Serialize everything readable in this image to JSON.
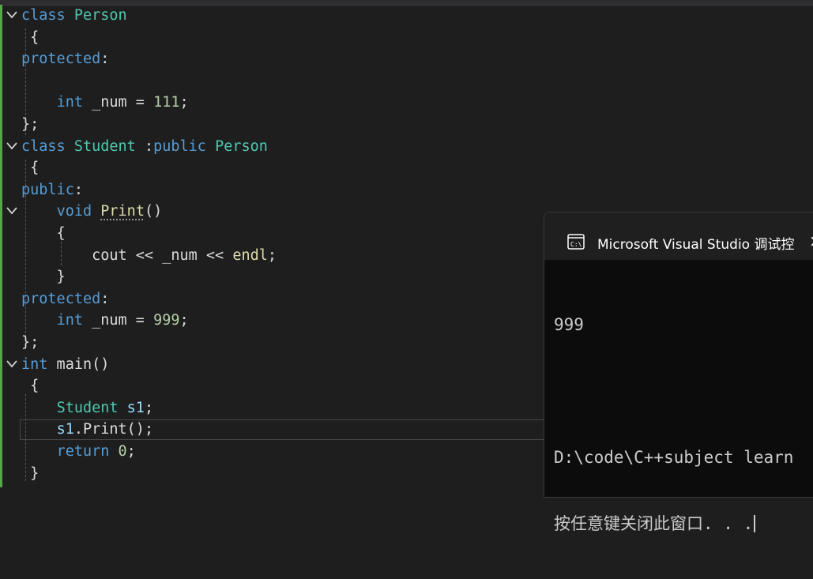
{
  "editor": {
    "lines": [
      {
        "t": [
          [
            "class",
            "kw"
          ],
          [
            " ",
            "pu"
          ],
          [
            "Person",
            "ty"
          ]
        ]
      },
      {
        "t": [
          [
            " {",
            "pu"
          ]
        ]
      },
      {
        "t": [
          [
            "protected",
            "kw"
          ],
          [
            ":",
            "pu"
          ]
        ]
      },
      {
        "t": [
          [
            "",
            "pu"
          ]
        ]
      },
      {
        "t": [
          [
            "    ",
            "pu"
          ],
          [
            "int",
            "kw"
          ],
          [
            " _num = ",
            "pu"
          ],
          [
            "111",
            "nm"
          ],
          [
            ";",
            "pu"
          ]
        ]
      },
      {
        "t": [
          [
            "};",
            "pu"
          ]
        ]
      },
      {
        "t": [
          [
            "class",
            "kw"
          ],
          [
            " ",
            "pu"
          ],
          [
            "Student",
            "ty"
          ],
          [
            " :",
            "pu"
          ],
          [
            "public",
            "kw"
          ],
          [
            " ",
            "pu"
          ],
          [
            "Person",
            "ty"
          ]
        ]
      },
      {
        "t": [
          [
            " {",
            "pu"
          ]
        ]
      },
      {
        "t": [
          [
            "public",
            "kw"
          ],
          [
            ":",
            "pu"
          ]
        ]
      },
      {
        "t": [
          [
            "    ",
            "pu"
          ],
          [
            "void",
            "kw"
          ],
          [
            " ",
            "pu"
          ],
          [
            "Print",
            "fn"
          ],
          [
            "()",
            "pu"
          ]
        ]
      },
      {
        "t": [
          [
            "    {",
            "pu"
          ]
        ]
      },
      {
        "t": [
          [
            "        cout << _num << ",
            "pu"
          ],
          [
            "endl",
            "fn"
          ],
          [
            ";",
            "pu"
          ]
        ]
      },
      {
        "t": [
          [
            "    }",
            "pu"
          ]
        ]
      },
      {
        "t": [
          [
            "protected",
            "kw"
          ],
          [
            ":",
            "pu"
          ]
        ]
      },
      {
        "t": [
          [
            "    ",
            "pu"
          ],
          [
            "int",
            "kw"
          ],
          [
            " _num = ",
            "pu"
          ],
          [
            "999",
            "nm"
          ],
          [
            ";",
            "pu"
          ]
        ]
      },
      {
        "t": [
          [
            "};",
            "pu"
          ]
        ]
      },
      {
        "t": [
          [
            "int",
            "kw"
          ],
          [
            " main()",
            "pu"
          ]
        ]
      },
      {
        "t": [
          [
            " {",
            "pu"
          ]
        ]
      },
      {
        "t": [
          [
            "    ",
            "pu"
          ],
          [
            "Student",
            "ty"
          ],
          [
            " ",
            "pu"
          ],
          [
            "s1",
            "vr"
          ],
          [
            ";",
            "pu"
          ]
        ]
      },
      {
        "t": [
          [
            "    ",
            "pu"
          ],
          [
            "s1",
            "vr"
          ],
          [
            ".Print();",
            "pu"
          ]
        ]
      },
      {
        "t": [
          [
            "    ",
            "pu"
          ],
          [
            "return",
            "kw"
          ],
          [
            " ",
            "pu"
          ],
          [
            "0",
            "nm"
          ],
          [
            ";",
            "pu"
          ]
        ]
      },
      {
        "t": [
          [
            " }",
            "pu"
          ]
        ]
      }
    ],
    "fold_lines": [
      0,
      6,
      9,
      16
    ],
    "colors": {
      "keyword": "#569cd6",
      "type": "#4ec9b0",
      "function": "#dcdcaa",
      "number": "#b5cea8",
      "variable": "#9cdcfe",
      "text": "#dcdcdc",
      "background": "#1e1e1e",
      "change_bar": "#57a64a"
    }
  },
  "console": {
    "title": "Microsoft Visual Studio 调试控",
    "close_glyph": "×",
    "output_line_1": "999",
    "output_line_2": "",
    "output_line_3": "D:\\code\\C++subject learn",
    "output_line_4": "按任意键关闭此窗口. . ."
  }
}
